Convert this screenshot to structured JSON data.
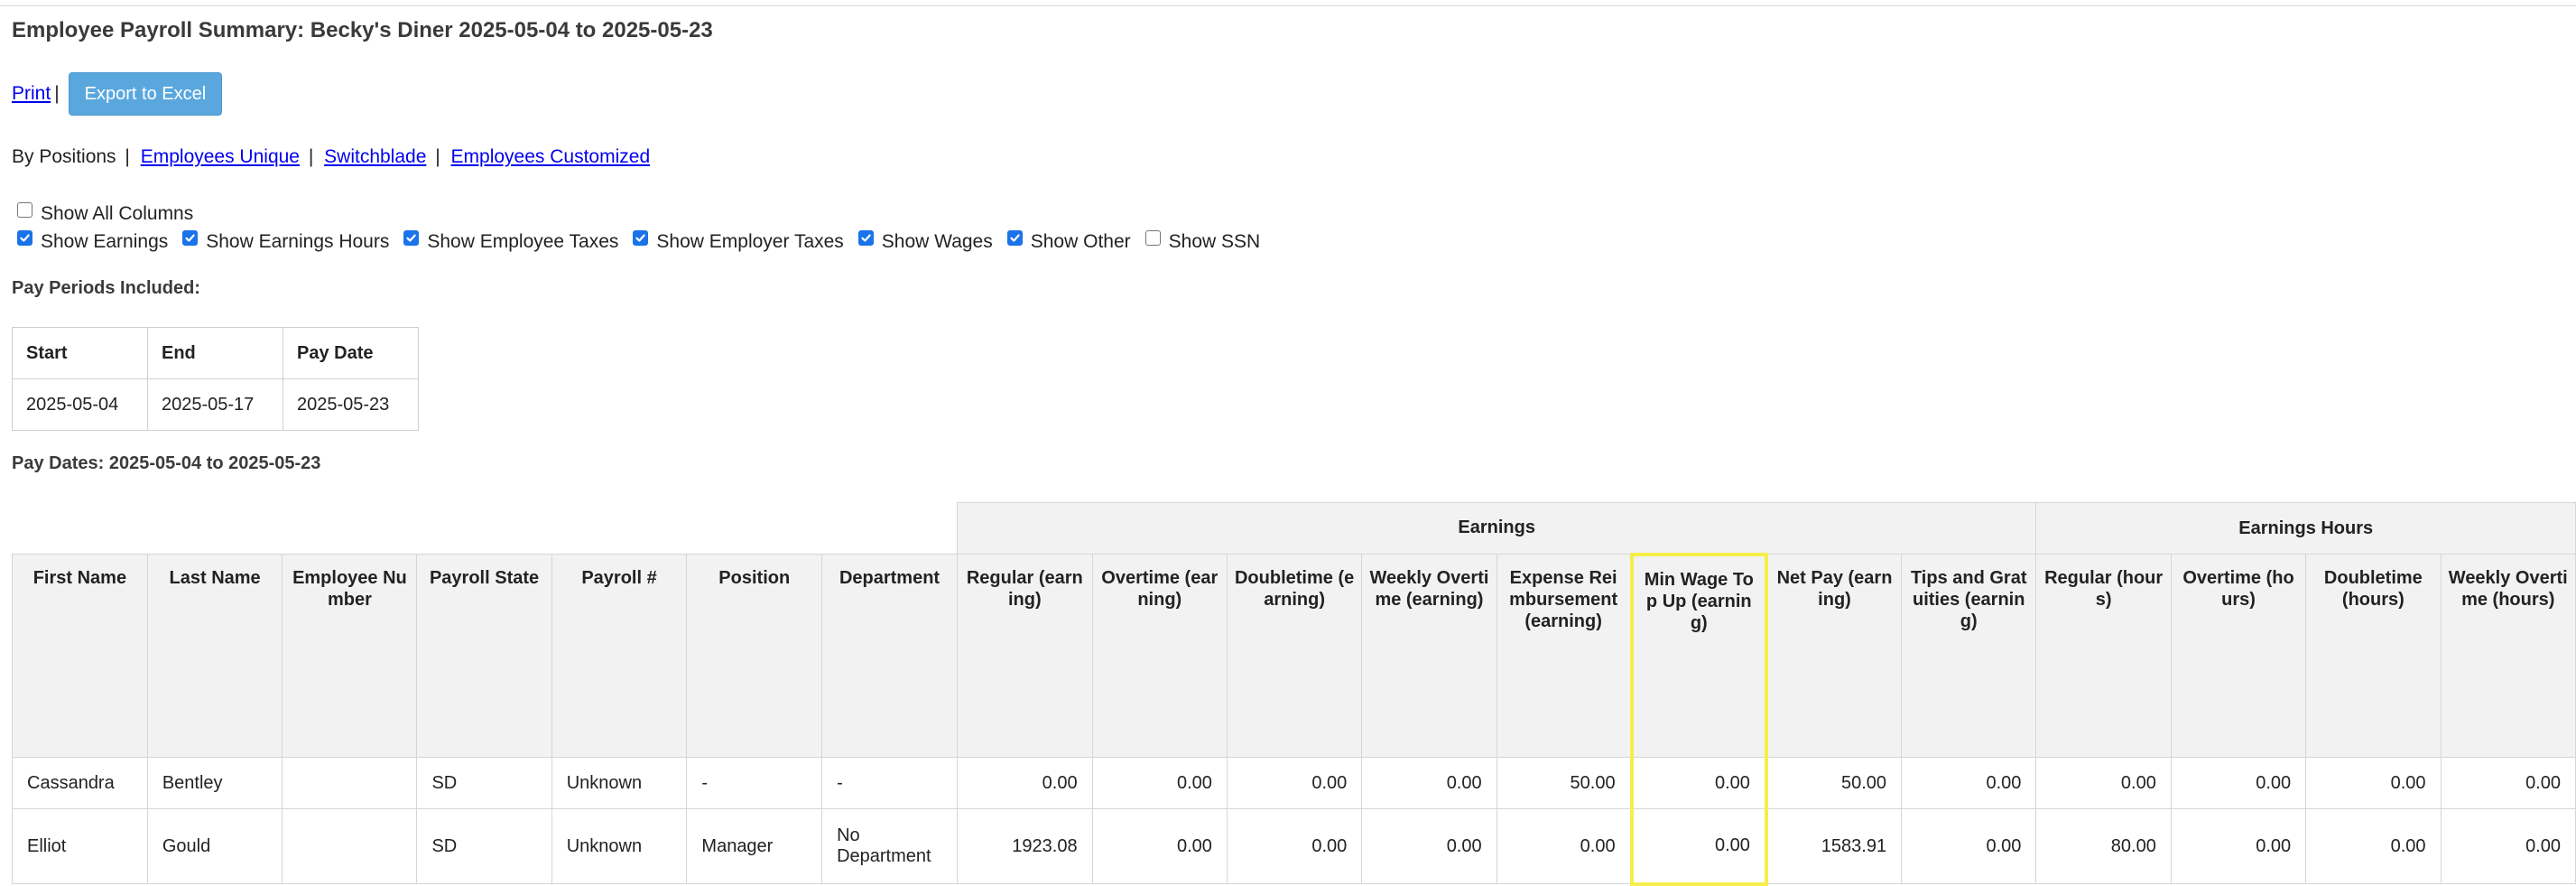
{
  "page": {
    "title": "Employee Payroll Summary: Becky's Diner 2025-05-04 to 2025-05-23"
  },
  "actions": {
    "print_label": "Print",
    "separator": "|",
    "export_label": "Export to Excel"
  },
  "views": {
    "current": "By Positions",
    "separator": "|",
    "links": [
      "Employees Unique",
      "Switchblade",
      "Employees Customized"
    ]
  },
  "column_toggles": {
    "row1": [
      {
        "label": "Show All Columns",
        "checked": false
      }
    ],
    "row2": [
      {
        "label": "Show Earnings",
        "checked": true
      },
      {
        "label": "Show Earnings Hours",
        "checked": true
      },
      {
        "label": "Show Employee Taxes",
        "checked": true
      },
      {
        "label": "Show Employer Taxes",
        "checked": true
      },
      {
        "label": "Show Wages",
        "checked": true
      },
      {
        "label": "Show Other",
        "checked": true
      },
      {
        "label": "Show SSN",
        "checked": false
      }
    ]
  },
  "pay_periods": {
    "heading": "Pay Periods Included:",
    "columns": [
      "Start",
      "End",
      "Pay Date"
    ],
    "rows": [
      [
        "2025-05-04",
        "2025-05-17",
        "2025-05-23"
      ]
    ]
  },
  "pay_dates_heading": "Pay Dates: 2025-05-04 to 2025-05-23",
  "payroll_table": {
    "groups": {
      "earnings": "Earnings",
      "earnings_hours": "Earnings Hours"
    },
    "columns": [
      "First Name",
      "Last Name",
      "Employee Number",
      "Payroll State",
      "Payroll #",
      "Position",
      "Department",
      "Regular (earning)",
      "Overtime (earning)",
      "Doubletime (earning)",
      "Weekly Overtime (earning)",
      "Expense Reimbursement (earning)",
      "Min Wage Top Up (earning)",
      "Net Pay (earning)",
      "Tips and Gratuities (earning)",
      "Regular (hours)",
      "Overtime (hours)",
      "Doubletime (hours)",
      "Weekly Overtime (hours)"
    ],
    "rows": [
      [
        "Cassandra",
        "Bentley",
        "",
        "SD",
        "Unknown",
        "-",
        "-",
        "0.00",
        "0.00",
        "0.00",
        "0.00",
        "50.00",
        "0.00",
        "50.00",
        "0.00",
        "0.00",
        "0.00",
        "0.00",
        "0.00"
      ],
      [
        "Elliot",
        "Gould",
        "",
        "SD",
        "Unknown",
        "Manager",
        "No Department",
        "1923.08",
        "0.00",
        "0.00",
        "0.00",
        "0.00",
        "0.00",
        "1583.91",
        "0.00",
        "80.00",
        "0.00",
        "0.00",
        "0.00"
      ]
    ],
    "highlighted_column": "Min Wage Top Up (earning)",
    "highlight_color": "#f6ee4a"
  },
  "colors": {
    "export_button": "#5aa7de",
    "checkbox_checked": "#1a73e8",
    "link": "#0000ee",
    "header_bg": "#f2f2f2"
  }
}
